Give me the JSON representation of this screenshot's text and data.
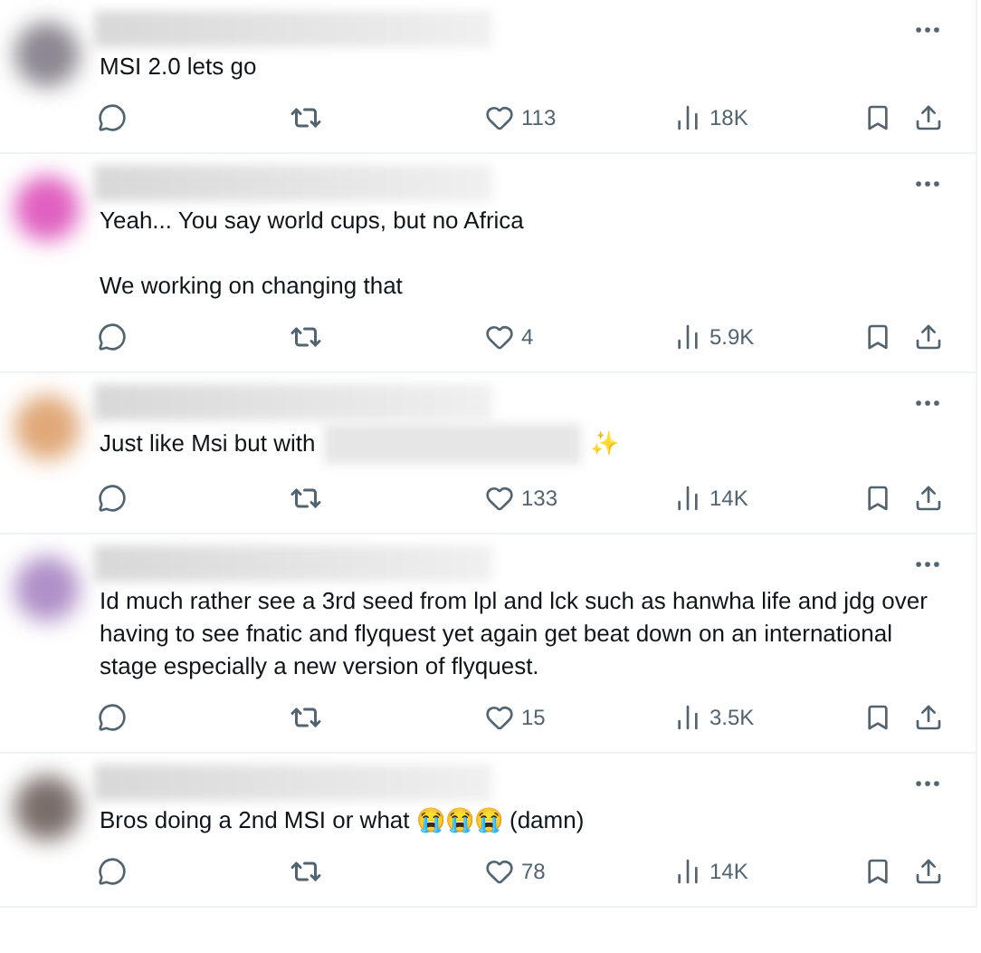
{
  "tweets": [
    {
      "color": "#8c8790",
      "paragraphs": [
        [
          {
            "kind": "text",
            "text": "MSI 2.0 lets go"
          }
        ]
      ],
      "likes": "113",
      "views": "18K"
    },
    {
      "color": "#e060c0",
      "paragraphs": [
        [
          {
            "kind": "text",
            "text": "Yeah... You say world cups, but no Africa"
          }
        ],
        [
          {
            "kind": "text",
            "text": "We working on changing that"
          }
        ]
      ],
      "likes": "4",
      "views": "5.9K"
    },
    {
      "color": "#e0a878",
      "paragraphs": [
        [
          {
            "kind": "text",
            "text": "Just like Msi but with"
          },
          {
            "kind": "redacted"
          },
          {
            "kind": "text",
            "text": "✨"
          }
        ]
      ],
      "likes": "133",
      "views": "14K"
    },
    {
      "color": "#b090c8",
      "paragraphs": [
        [
          {
            "kind": "text",
            "text": "Id much rather see a 3rd seed from lpl and lck such as hanwha life and jdg over having to see fnatic and flyquest yet again get beat down on an international stage especially a new version of flyquest."
          }
        ]
      ],
      "likes": "15",
      "views": "3.5K"
    },
    {
      "color": "#7a6e6a",
      "paragraphs": [
        [
          {
            "kind": "text",
            "text": "Bros doing a 2nd MSI or what 😭😭😭 (damn)"
          }
        ]
      ],
      "likes": "78",
      "views": "14K"
    }
  ]
}
